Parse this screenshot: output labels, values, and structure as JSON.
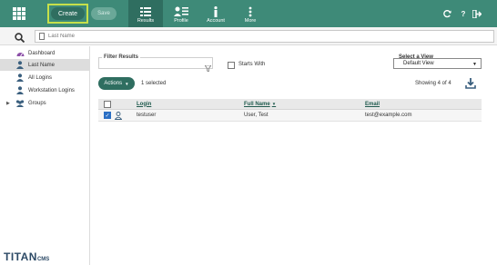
{
  "header": {
    "create_label": "Create",
    "save_label": "Save",
    "tabs": [
      {
        "label": "Results",
        "icon": "list-icon"
      },
      {
        "label": "Profile",
        "icon": "profile-icon"
      },
      {
        "label": "Account",
        "icon": "info-icon"
      },
      {
        "label": "More",
        "icon": "more-icon"
      }
    ],
    "right_icons": [
      "refresh-icon",
      "help-icon",
      "logout-icon"
    ]
  },
  "search": {
    "placeholder": "Last Name",
    "value": ""
  },
  "sidebar": {
    "items": [
      {
        "label": "Dashboard",
        "icon": "dashboard-icon"
      },
      {
        "label": "Last Name",
        "icon": "person-icon"
      },
      {
        "label": "All Logins",
        "icon": "person-icon"
      },
      {
        "label": "Workstation Logins",
        "icon": "person-icon"
      },
      {
        "label": "Groups",
        "icon": "group-icon"
      }
    ]
  },
  "logo": {
    "main": "TITAN",
    "sub": "CMS"
  },
  "filter": {
    "legend": "Filter Results",
    "value": "",
    "starts_with_label": "Starts With"
  },
  "view": {
    "legend": "Select a View",
    "selected": "Default View"
  },
  "toolbar": {
    "actions_label": "Actions",
    "selected_text": "1 selected",
    "showing_text": "Showing 4 of 4"
  },
  "table": {
    "columns": [
      "Login",
      "Full Name",
      "Email"
    ],
    "rows": [
      {
        "login": "testuser",
        "full_name": "User, Test",
        "email": "test@example.com"
      }
    ]
  },
  "colors": {
    "topbar": "#3e8a78",
    "active_tab": "#2f6e60",
    "highlight": "#c6e04a"
  }
}
